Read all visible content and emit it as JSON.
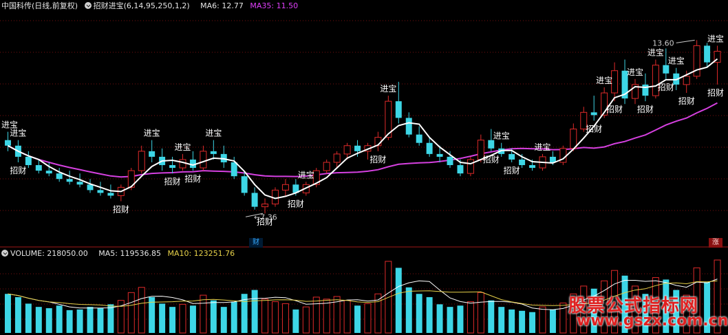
{
  "header_top": {
    "stock_name": "中国科传(日线,前复权)",
    "indicator": "招财进宝(6,14,95,250,1,2)",
    "ma6": "MA6: 12.77",
    "ma35": "MA35: 11.50"
  },
  "header_volume": {
    "volume": "VOLUME: 218050.00",
    "ma5": "MA5: 119536.85",
    "ma10": "MA10: 123251.76"
  },
  "badges": {
    "zhang": "涨",
    "cai": "财"
  },
  "watermark": {
    "title": "股票公式指标网",
    "url": "www.gszx.com.cn"
  },
  "colors": {
    "up": "#e02a2a",
    "down": "#3dd6e6",
    "ma6": "#ffffff",
    "ma35": "#d640e0",
    "vol_ma5": "#ffffff",
    "vol_ma10": "#e8d24a",
    "grid": "#7a1010",
    "text_signal": "#ffffff"
  },
  "chart_data": {
    "type": "candlestick",
    "price_range": [
      6.5,
      14.5
    ],
    "marked_high": "13.60",
    "marked_low": "7.36",
    "candles": [
      {
        "o": 10.0,
        "h": 10.3,
        "l": 9.6,
        "c": 9.8,
        "v": 60
      },
      {
        "o": 9.8,
        "h": 10.0,
        "l": 9.2,
        "c": 9.4,
        "v": 55
      },
      {
        "o": 9.4,
        "h": 9.6,
        "l": 9.0,
        "c": 9.1,
        "v": 45
      },
      {
        "o": 9.1,
        "h": 9.3,
        "l": 8.8,
        "c": 8.9,
        "v": 40
      },
      {
        "o": 8.9,
        "h": 9.2,
        "l": 8.7,
        "c": 8.8,
        "v": 38
      },
      {
        "o": 8.8,
        "h": 9.0,
        "l": 8.5,
        "c": 8.6,
        "v": 42
      },
      {
        "o": 8.6,
        "h": 8.9,
        "l": 8.4,
        "c": 8.5,
        "v": 35
      },
      {
        "o": 8.5,
        "h": 8.8,
        "l": 8.3,
        "c": 8.4,
        "v": 36
      },
      {
        "o": 8.4,
        "h": 8.6,
        "l": 8.1,
        "c": 8.2,
        "v": 40
      },
      {
        "o": 8.2,
        "h": 8.5,
        "l": 8.0,
        "c": 8.1,
        "v": 38
      },
      {
        "o": 8.1,
        "h": 8.4,
        "l": 7.9,
        "c": 8.0,
        "v": 44
      },
      {
        "o": 8.0,
        "h": 8.4,
        "l": 7.8,
        "c": 8.3,
        "v": 50
      },
      {
        "o": 8.3,
        "h": 9.0,
        "l": 8.2,
        "c": 8.9,
        "v": 62
      },
      {
        "o": 8.9,
        "h": 9.8,
        "l": 8.8,
        "c": 9.6,
        "v": 70
      },
      {
        "o": 9.6,
        "h": 10.0,
        "l": 9.2,
        "c": 9.4,
        "v": 55
      },
      {
        "o": 9.4,
        "h": 9.7,
        "l": 8.9,
        "c": 9.1,
        "v": 45
      },
      {
        "o": 9.1,
        "h": 9.4,
        "l": 8.8,
        "c": 9.0,
        "v": 40
      },
      {
        "o": 9.0,
        "h": 9.5,
        "l": 8.9,
        "c": 9.3,
        "v": 44
      },
      {
        "o": 9.3,
        "h": 9.6,
        "l": 8.9,
        "c": 9.0,
        "v": 42
      },
      {
        "o": 9.0,
        "h": 9.8,
        "l": 8.9,
        "c": 9.6,
        "v": 58
      },
      {
        "o": 9.6,
        "h": 10.0,
        "l": 9.3,
        "c": 9.5,
        "v": 50
      },
      {
        "o": 9.5,
        "h": 9.8,
        "l": 9.0,
        "c": 9.2,
        "v": 40
      },
      {
        "o": 9.2,
        "h": 9.4,
        "l": 8.6,
        "c": 8.7,
        "v": 48
      },
      {
        "o": 8.7,
        "h": 8.9,
        "l": 8.0,
        "c": 8.1,
        "v": 60
      },
      {
        "o": 8.1,
        "h": 8.3,
        "l": 7.5,
        "c": 7.6,
        "v": 66
      },
      {
        "o": 7.6,
        "h": 7.9,
        "l": 7.36,
        "c": 7.7,
        "v": 52
      },
      {
        "o": 7.7,
        "h": 8.3,
        "l": 7.6,
        "c": 8.2,
        "v": 48
      },
      {
        "o": 8.2,
        "h": 8.6,
        "l": 8.0,
        "c": 8.4,
        "v": 45
      },
      {
        "o": 8.4,
        "h": 8.6,
        "l": 8.0,
        "c": 8.1,
        "v": 36
      },
      {
        "o": 8.1,
        "h": 8.5,
        "l": 8.0,
        "c": 8.4,
        "v": 40
      },
      {
        "o": 8.4,
        "h": 9.0,
        "l": 8.3,
        "c": 8.9,
        "v": 55
      },
      {
        "o": 8.9,
        "h": 9.3,
        "l": 8.8,
        "c": 9.2,
        "v": 52
      },
      {
        "o": 9.2,
        "h": 9.6,
        "l": 9.0,
        "c": 9.5,
        "v": 56
      },
      {
        "o": 9.5,
        "h": 9.9,
        "l": 9.3,
        "c": 9.8,
        "v": 50
      },
      {
        "o": 9.8,
        "h": 10.0,
        "l": 9.4,
        "c": 9.6,
        "v": 42
      },
      {
        "o": 9.6,
        "h": 9.9,
        "l": 9.3,
        "c": 9.8,
        "v": 45
      },
      {
        "o": 9.8,
        "h": 10.3,
        "l": 9.6,
        "c": 10.1,
        "v": 60
      },
      {
        "o": 10.1,
        "h": 11.6,
        "l": 10.0,
        "c": 11.4,
        "v": 110
      },
      {
        "o": 11.4,
        "h": 12.1,
        "l": 10.6,
        "c": 10.8,
        "v": 100
      },
      {
        "o": 10.8,
        "h": 11.0,
        "l": 10.1,
        "c": 10.2,
        "v": 70
      },
      {
        "o": 10.2,
        "h": 10.5,
        "l": 9.8,
        "c": 9.9,
        "v": 60
      },
      {
        "o": 9.9,
        "h": 10.1,
        "l": 9.4,
        "c": 9.5,
        "v": 55
      },
      {
        "o": 9.5,
        "h": 9.8,
        "l": 9.2,
        "c": 9.4,
        "v": 44
      },
      {
        "o": 9.4,
        "h": 9.6,
        "l": 9.0,
        "c": 9.1,
        "v": 40
      },
      {
        "o": 9.1,
        "h": 9.3,
        "l": 8.7,
        "c": 8.8,
        "v": 42
      },
      {
        "o": 8.8,
        "h": 9.4,
        "l": 8.7,
        "c": 9.3,
        "v": 48
      },
      {
        "o": 9.3,
        "h": 10.2,
        "l": 9.2,
        "c": 10.0,
        "v": 62
      },
      {
        "o": 10.0,
        "h": 10.4,
        "l": 9.6,
        "c": 9.7,
        "v": 50
      },
      {
        "o": 9.7,
        "h": 9.9,
        "l": 9.4,
        "c": 9.5,
        "v": 40
      },
      {
        "o": 9.5,
        "h": 9.7,
        "l": 9.2,
        "c": 9.3,
        "v": 36
      },
      {
        "o": 9.3,
        "h": 9.5,
        "l": 9.0,
        "c": 9.1,
        "v": 34
      },
      {
        "o": 9.1,
        "h": 9.3,
        "l": 8.9,
        "c": 9.0,
        "v": 32
      },
      {
        "o": 9.0,
        "h": 9.5,
        "l": 8.9,
        "c": 9.4,
        "v": 40
      },
      {
        "o": 9.4,
        "h": 9.6,
        "l": 9.1,
        "c": 9.2,
        "v": 36
      },
      {
        "o": 9.2,
        "h": 9.8,
        "l": 9.1,
        "c": 9.7,
        "v": 46
      },
      {
        "o": 9.7,
        "h": 10.6,
        "l": 9.6,
        "c": 10.4,
        "v": 60
      },
      {
        "o": 10.4,
        "h": 11.2,
        "l": 10.3,
        "c": 11.0,
        "v": 72
      },
      {
        "o": 11.0,
        "h": 11.6,
        "l": 10.7,
        "c": 10.9,
        "v": 68
      },
      {
        "o": 10.9,
        "h": 11.9,
        "l": 10.8,
        "c": 11.7,
        "v": 80
      },
      {
        "o": 11.7,
        "h": 12.8,
        "l": 11.4,
        "c": 12.5,
        "v": 96
      },
      {
        "o": 12.5,
        "h": 12.9,
        "l": 11.3,
        "c": 11.5,
        "v": 88
      },
      {
        "o": 11.5,
        "h": 12.2,
        "l": 11.3,
        "c": 12.0,
        "v": 72
      },
      {
        "o": 12.0,
        "h": 12.4,
        "l": 11.4,
        "c": 11.6,
        "v": 60
      },
      {
        "o": 11.6,
        "h": 12.9,
        "l": 11.5,
        "c": 12.7,
        "v": 85
      },
      {
        "o": 12.7,
        "h": 13.3,
        "l": 12.2,
        "c": 12.4,
        "v": 82
      },
      {
        "o": 12.4,
        "h": 12.6,
        "l": 11.8,
        "c": 12.0,
        "v": 66
      },
      {
        "o": 12.0,
        "h": 12.5,
        "l": 11.7,
        "c": 12.3,
        "v": 58
      },
      {
        "o": 12.3,
        "h": 13.6,
        "l": 12.2,
        "c": 13.4,
        "v": 100
      },
      {
        "o": 13.4,
        "h": 13.5,
        "l": 12.6,
        "c": 12.8,
        "v": 78
      },
      {
        "o": 12.8,
        "h": 13.4,
        "l": 12.0,
        "c": 13.2,
        "v": 112
      }
    ],
    "signals": [
      {
        "label": "进宝",
        "i": 0,
        "pos": "above"
      },
      {
        "label": "进宝",
        "i": 1,
        "pos": "above"
      },
      {
        "label": "招财",
        "i": 1,
        "pos": "below"
      },
      {
        "label": "招财",
        "i": 11,
        "pos": "below"
      },
      {
        "label": "进宝",
        "i": 14,
        "pos": "above"
      },
      {
        "label": "进宝",
        "i": 17,
        "pos": "above"
      },
      {
        "label": "招财",
        "i": 16,
        "pos": "below"
      },
      {
        "label": "招财",
        "i": 18,
        "pos": "below"
      },
      {
        "label": "进宝",
        "i": 20,
        "pos": "above"
      },
      {
        "label": "招财",
        "i": 25,
        "pos": "below"
      },
      {
        "label": "招财",
        "i": 28,
        "pos": "below"
      },
      {
        "label": "进宝",
        "i": 29,
        "pos": "above"
      },
      {
        "label": "进宝",
        "i": 37,
        "pos": "above"
      },
      {
        "label": "招财",
        "i": 36,
        "pos": "below"
      },
      {
        "label": "进宝",
        "i": 48,
        "pos": "above"
      },
      {
        "label": "招财",
        "i": 47,
        "pos": "below"
      },
      {
        "label": "招财",
        "i": 49,
        "pos": "below"
      },
      {
        "label": "进宝",
        "i": 52,
        "pos": "above"
      },
      {
        "label": "招财",
        "i": 57,
        "pos": "below"
      },
      {
        "label": "进宝",
        "i": 58,
        "pos": "above"
      },
      {
        "label": "招财",
        "i": 59,
        "pos": "below"
      },
      {
        "label": "进宝",
        "i": 61,
        "pos": "above"
      },
      {
        "label": "招财",
        "i": 62,
        "pos": "below"
      },
      {
        "label": "进宝",
        "i": 63,
        "pos": "above"
      },
      {
        "label": "招财",
        "i": 64,
        "pos": "below"
      },
      {
        "label": "进宝",
        "i": 65,
        "pos": "above"
      },
      {
        "label": "招财",
        "i": 66,
        "pos": "below"
      },
      {
        "label": "进宝",
        "i": 69,
        "pos": "above"
      },
      {
        "label": "招财",
        "i": 69,
        "pos": "below"
      }
    ]
  }
}
